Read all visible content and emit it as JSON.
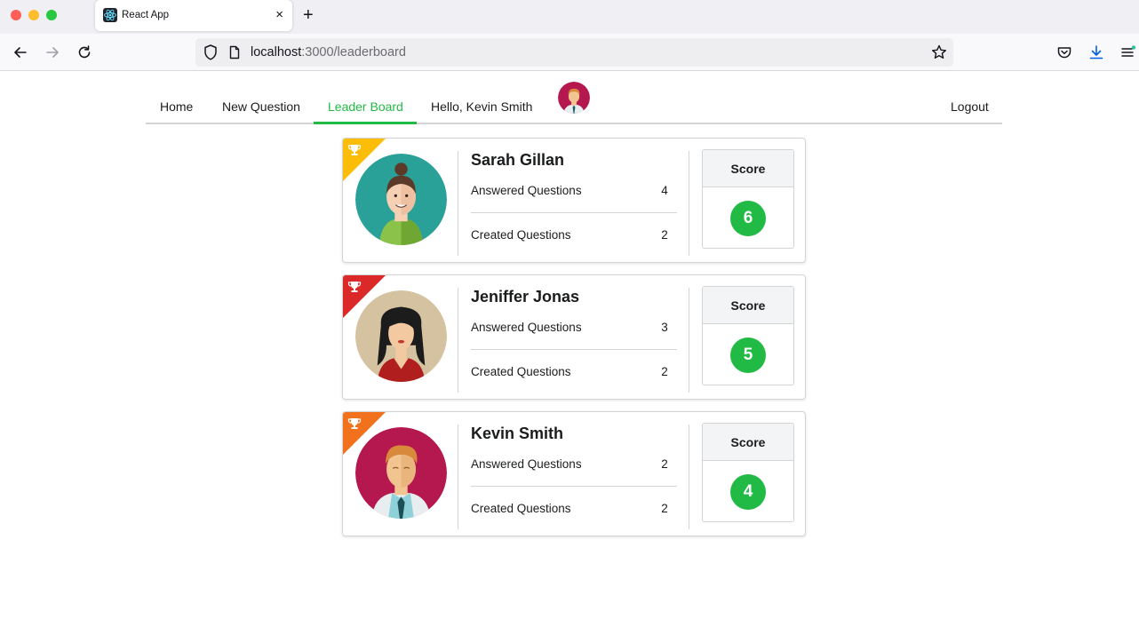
{
  "browser": {
    "tab_title": "React App",
    "tab_close": "×",
    "new_tab": "+",
    "url_host": "localhost",
    "url_rest": ":3000/leaderboard"
  },
  "nav": {
    "items": [
      {
        "label": "Home"
      },
      {
        "label": "New Question"
      },
      {
        "label": "Leader Board",
        "active": true
      },
      {
        "label": "Hello, Kevin Smith"
      }
    ],
    "logout": "Logout"
  },
  "leaderboard": [
    {
      "name": "Sarah Gillan",
      "answered_label": "Answered Questions",
      "answered": "4",
      "created_label": "Created Questions",
      "created": "2",
      "score_label": "Score",
      "score": "6",
      "ribbon_color": "#fbbd08",
      "avatar_bg": "#2aa198"
    },
    {
      "name": "Jeniffer Jonas",
      "answered_label": "Answered Questions",
      "answered": "3",
      "created_label": "Created Questions",
      "created": "2",
      "score_label": "Score",
      "score": "5",
      "ribbon_color": "#db2828",
      "avatar_bg": "#d4c2a0"
    },
    {
      "name": "Kevin Smith",
      "answered_label": "Answered Questions",
      "answered": "2",
      "created_label": "Created Questions",
      "created": "2",
      "score_label": "Score",
      "score": "4",
      "ribbon_color": "#f2711c",
      "avatar_bg": "#b5174f"
    }
  ],
  "colors": {
    "accent_green": "#21ba45"
  }
}
